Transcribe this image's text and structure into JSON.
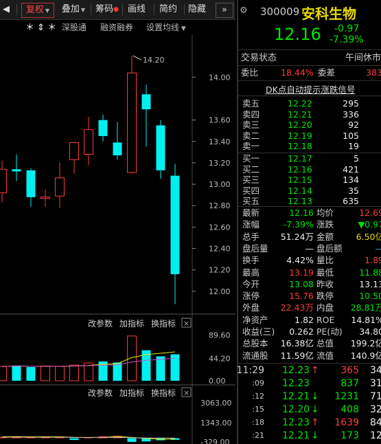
{
  "toolbar": {
    "left_arrow": "◀",
    "fuquan": "复权",
    "diejia": "叠加",
    "chouma": "筹码",
    "huaxian": "画线",
    "jianyue": "简约",
    "yincang": "隐藏",
    "more": "»",
    "shenguton": "深股通",
    "rongzi": "融资融券",
    "junxian": "设置均线",
    "markers": "＊ ⇕ ＊"
  },
  "stock": {
    "code": "300009",
    "name": "安科生物",
    "price": "12.16",
    "change": "-0.97",
    "change_pct": "-7.39%",
    "status_label": "交易状态",
    "status_value": "午间休市",
    "weibi_label": "委比",
    "weibi_value": "18.44%",
    "weicha_label": "委差",
    "weicha_value": "383",
    "signal": "DK点自动提示涨跌信号"
  },
  "sell_orders": [
    {
      "label": "卖五",
      "price": "12.22",
      "vol": "295"
    },
    {
      "label": "卖四",
      "price": "12.21",
      "vol": "336"
    },
    {
      "label": "卖三",
      "price": "12.20",
      "vol": "92"
    },
    {
      "label": "卖二",
      "price": "12.19",
      "vol": "105"
    },
    {
      "label": "卖一",
      "price": "12.18",
      "vol": "19"
    }
  ],
  "buy_orders": [
    {
      "label": "买一",
      "price": "12.17",
      "vol": "5"
    },
    {
      "label": "买二",
      "price": "12.16",
      "vol": "421"
    },
    {
      "label": "买三",
      "price": "12.15",
      "vol": "134"
    },
    {
      "label": "买四",
      "price": "12.14",
      "vol": "35"
    },
    {
      "label": "买五",
      "price": "12.13",
      "vol": "635"
    }
  ],
  "stats": [
    {
      "l1": "最新",
      "v1": "12.16",
      "c1": "green",
      "l2": "均价",
      "v2": "12.69",
      "c2": "red"
    },
    {
      "l1": "涨幅",
      "v1": "-7.39%",
      "c1": "green",
      "l2": "涨跌",
      "v2": "▼0.97",
      "c2": "green"
    },
    {
      "l1": "总手",
      "v1": "51.24万",
      "c1": "white",
      "l2": "金额",
      "v2": "6.50亿",
      "c2": "yellow"
    },
    {
      "l1": "盘后量",
      "v1": "—",
      "c1": "white",
      "l2": "盘后额",
      "v2": "—",
      "c2": "cyan"
    },
    {
      "l1": "换手",
      "v1": "4.42%",
      "c1": "white",
      "l2": "量比",
      "v2": "1.89",
      "c2": "red"
    },
    {
      "l1": "最高",
      "v1": "13.19",
      "c1": "red",
      "l2": "最低",
      "v2": "11.88",
      "c2": "green"
    },
    {
      "l1": "今开",
      "v1": "13.08",
      "c1": "green",
      "l2": "昨收",
      "v2": "13.13",
      "c2": "white"
    },
    {
      "l1": "涨停",
      "v1": "15.76",
      "c1": "red",
      "l2": "跌停",
      "v2": "10.50",
      "c2": "green"
    },
    {
      "l1": "外盘",
      "v1": "22.43万",
      "c1": "red",
      "l2": "内盘",
      "v2": "28.81万",
      "c2": "green"
    },
    {
      "l1": "净资产",
      "v1": "1.82",
      "c1": "white",
      "l2": "ROE",
      "v2": "14.81%",
      "c2": "white"
    },
    {
      "l1": "收益(三)",
      "v1": "0.262",
      "c1": "white",
      "l2": "PE(动)",
      "v2": "34.80",
      "c2": "white"
    },
    {
      "l1": "总股本",
      "v1": "16.38亿",
      "c1": "white",
      "l2": "总值",
      "v2": "199.2亿",
      "c2": "white"
    },
    {
      "l1": "流通股",
      "v1": "11.59亿",
      "c1": "white",
      "l2": "流值",
      "v2": "140.9亿",
      "c2": "white"
    }
  ],
  "ticks": [
    {
      "time": "11:29",
      "price": "12.23",
      "arrow": "↑",
      "acolor": "red",
      "vol": "365",
      "vcolor": "red",
      "n": "34"
    },
    {
      "time": ":09",
      "price": "12.23",
      "arrow": "",
      "acolor": "red",
      "vol": "837",
      "vcolor": "green",
      "n": "31"
    },
    {
      "time": ":12",
      "price": "12.21",
      "arrow": "↓",
      "acolor": "green",
      "vol": "1231",
      "vcolor": "green",
      "n": "71"
    },
    {
      "time": ":15",
      "price": "12.20",
      "arrow": "↓",
      "acolor": "green",
      "vol": "408",
      "vcolor": "green",
      "n": "32"
    },
    {
      "time": ":18",
      "price": "12.23",
      "arrow": "↑",
      "acolor": "red",
      "vol": "1639",
      "vcolor": "red",
      "n": "84"
    },
    {
      "time": ":21",
      "price": "12.21",
      "arrow": "↓",
      "acolor": "green",
      "vol": "173",
      "vcolor": "green",
      "n": "12"
    }
  ],
  "indicator_bar": {
    "param": "改参数",
    "add": "加指标",
    "switch": "换指标",
    "close": "×"
  },
  "chart_data": [
    {
      "type": "candlestick",
      "y_ticks": [
        "14.00",
        "13.60",
        "13.40",
        "13.20",
        "13.00",
        "12.80",
        "12.60",
        "12.40",
        "12.20",
        "12.00"
      ],
      "ylim": [
        11.8,
        14.4
      ],
      "max_label": "14.20",
      "candles": [
        {
          "o": 13.14,
          "h": 13.22,
          "l": 12.83,
          "c": 12.92,
          "up": true
        },
        {
          "o": 13.14,
          "h": 13.28,
          "l": 13.03,
          "c": 13.12,
          "up": false
        },
        {
          "o": 13.13,
          "h": 13.15,
          "l": 12.79,
          "c": 12.88,
          "up": false
        },
        {
          "o": 12.88,
          "h": 12.95,
          "l": 12.79,
          "c": 12.87,
          "up": true
        },
        {
          "o": 12.89,
          "h": 13.2,
          "l": 12.78,
          "c": 13.06,
          "up": true
        },
        {
          "o": 13.23,
          "h": 13.4,
          "l": 13.1,
          "c": 13.39,
          "up": true
        },
        {
          "o": 13.28,
          "h": 13.63,
          "l": 13.18,
          "c": 13.51,
          "up": true
        },
        {
          "o": 13.6,
          "h": 13.65,
          "l": 13.4,
          "c": 13.45,
          "up": false
        },
        {
          "o": 13.39,
          "h": 13.58,
          "l": 13.23,
          "c": 13.27,
          "up": false
        },
        {
          "o": 13.11,
          "h": 14.2,
          "l": 13.1,
          "c": 14.04,
          "up": true
        },
        {
          "o": 13.84,
          "h": 13.93,
          "l": 13.35,
          "c": 13.7,
          "up": false
        },
        {
          "o": 13.55,
          "h": 13.6,
          "l": 13.05,
          "c": 13.13,
          "up": false
        },
        {
          "o": 13.08,
          "h": 13.19,
          "l": 11.88,
          "c": 12.16,
          "up": false
        }
      ]
    },
    {
      "type": "bar",
      "name": "volume",
      "y_ticks": [
        "89.60",
        "44.20",
        "0.00"
      ],
      "ylim": [
        0,
        100
      ],
      "values": [
        28,
        30,
        27,
        29,
        28,
        31,
        35,
        38,
        36,
        88,
        60,
        48,
        52
      ],
      "up": [
        true,
        false,
        false,
        true,
        true,
        true,
        true,
        false,
        false,
        true,
        false,
        false,
        false
      ]
    },
    {
      "type": "bar",
      "name": "indicator",
      "y_ticks": [
        "3063.00",
        "1343.00",
        "-329.00"
      ],
      "ylim": [
        -500,
        3300
      ],
      "values": [
        120,
        130,
        80,
        140,
        100,
        -150,
        90,
        160,
        200,
        -320,
        -280,
        -180,
        -140
      ]
    }
  ]
}
